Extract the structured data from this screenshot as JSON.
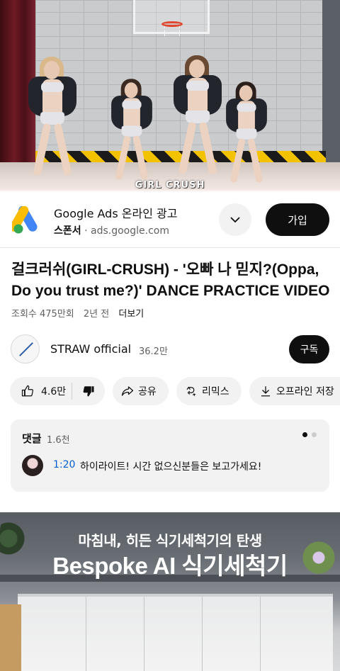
{
  "video": {
    "caption": "GIRL CRUSH",
    "progress": 0
  },
  "ad": {
    "title": "Google Ads 온라인 광고",
    "sponsor_label": "스폰서",
    "separator": "·",
    "domain": "ads.google.com",
    "join_label": "가입",
    "icons": [
      "google-ads-logo",
      "chevron-down-icon"
    ]
  },
  "title": "걸크러쉬(GIRL-CRUSH) - '오빠 나 믿지?(Oppa, Do you trust me?)' DANCE PRACTICE VIDEO",
  "meta": {
    "views": "조회수 475만회",
    "age": "2년 전",
    "more": "더보기"
  },
  "channel": {
    "name": "STRAW official",
    "subscribers": "36.2만",
    "subscribe_label": "구독"
  },
  "actions": {
    "likes": "4.6만",
    "share": "공유",
    "remix": "리믹스",
    "download": "오프라인 저장",
    "icons": [
      "thumbs-up-icon",
      "thumbs-down-icon",
      "share-icon",
      "remix-icon",
      "download-icon"
    ]
  },
  "comments": {
    "heading": "댓글",
    "count": "1.6천",
    "top_comment": {
      "timestamp": "1:20",
      "text": "하이라이트! 시간 없으신분들은 보고가세요!"
    }
  },
  "bottom_ad": {
    "line1": "마침내, 히든 식기세척기의 탄생",
    "line2": "Bespoke AI 식기세척기"
  },
  "colors": {
    "link_blue": "#065fd4",
    "button_dark": "#0f0f0f",
    "chip_bg": "#f2f2f2",
    "secondary_text": "#606060"
  }
}
